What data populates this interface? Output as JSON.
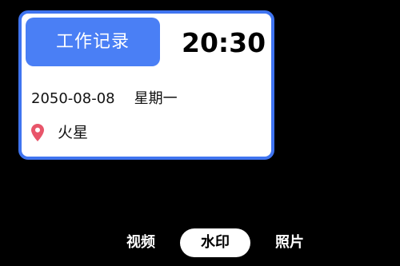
{
  "card": {
    "badge_label": "工作记录",
    "time": "20:30",
    "date": "2050-08-08",
    "weekday": "星期一",
    "location": "火星",
    "location_icon": "location-pin-icon"
  },
  "mode_bar": {
    "video_label": "视频",
    "watermark_label": "水印",
    "photo_label": "照片",
    "selected": "水印"
  },
  "colors": {
    "background": "#000000",
    "card_border": "#3f74f0",
    "badge_background": "#4a7ff5",
    "pin": "#e8556a"
  }
}
